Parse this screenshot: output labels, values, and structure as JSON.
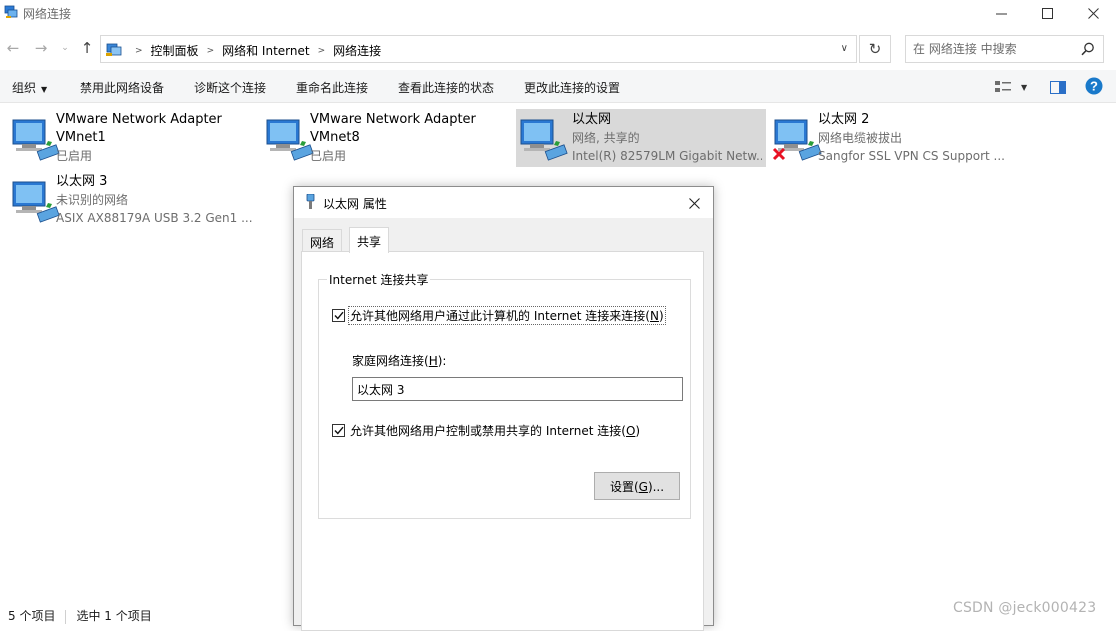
{
  "window": {
    "title": "网络连接",
    "buttons": {
      "minimize": "—",
      "maximize": "☐",
      "close": "✕"
    }
  },
  "nav": {
    "back": "←",
    "forward": "→",
    "recent": "⌄",
    "up": "↑",
    "breadcrumb": [
      "控制面板",
      "网络和 Internet",
      "网络连接"
    ],
    "refresh": "↻",
    "search_placeholder": "在 网络连接 中搜索"
  },
  "toolbar": {
    "organize": "组织",
    "commands": [
      "禁用此网络设备",
      "诊断这个连接",
      "重命名此连接",
      "查看此连接的状态",
      "更改此连接的设置"
    ]
  },
  "items": [
    {
      "name": "VMware Network Adapter",
      "line2": "VMnet1",
      "line3": "已启用",
      "disconnected": false,
      "selected": false
    },
    {
      "name": "VMware Network Adapter",
      "line2": "VMnet8",
      "line3": "已启用",
      "disconnected": false,
      "selected": false
    },
    {
      "name": "以太网",
      "line2": "网络, 共享的",
      "line3": "Intel(R) 82579LM Gigabit Netw...",
      "disconnected": false,
      "selected": true
    },
    {
      "name": "以太网 2",
      "line2": "网络电缆被拔出",
      "line3": "Sangfor SSL VPN CS Support ...",
      "disconnected": true,
      "selected": false
    },
    {
      "name": "以太网 3",
      "line2": "未识别的网络",
      "line3": "ASIX AX88179A USB 3.2 Gen1 ...",
      "disconnected": false,
      "selected": false
    }
  ],
  "status": {
    "count": "5 个项目",
    "selected": "选中 1 个项目"
  },
  "watermark": "CSDN @jeck000423",
  "dialog": {
    "title": "以太网 属性",
    "close": "✕",
    "tabs": {
      "network": "网络",
      "sharing": "共享"
    },
    "group_title": "Internet 连接共享",
    "allow_share": {
      "text": "允许其他网络用户通过此计算机的 Internet 连接来连接(",
      "key": "N",
      "end": ")",
      "checked": true
    },
    "home_network": {
      "text": "家庭网络连接(",
      "key": "H",
      "end": "):",
      "value": "以太网 3"
    },
    "allow_control": {
      "text": "允许其他网络用户控制或禁用共享的 Internet 连接(",
      "key": "O",
      "end": ")",
      "checked": true
    },
    "settings": {
      "text": "设置(",
      "key": "G",
      "end": ")..."
    }
  },
  "colors": {
    "selected_bg": "#d9d9d9",
    "disconnected_x": "#e81123",
    "help_blue": "#1979ca"
  }
}
